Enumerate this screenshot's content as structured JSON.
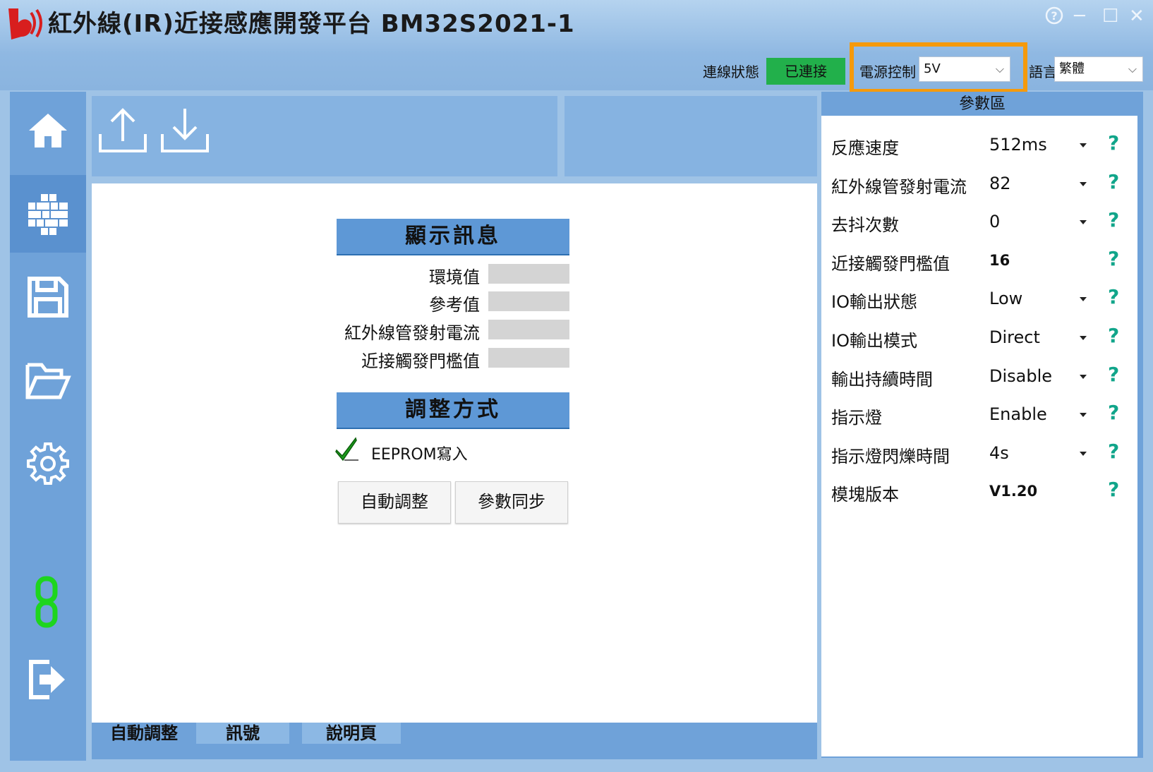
{
  "window": {
    "title": "紅外線(IR)近接感應開發平台 BM32S2021-1",
    "help_glyph": "?",
    "minimize_glyph": "─",
    "maximize_glyph": "☐",
    "close_glyph": "✕"
  },
  "status": {
    "connection_label": "連線狀態",
    "connection_value": "已連接",
    "connection_color": "#22b04b",
    "power_label": "電源控制",
    "power_value": "5V",
    "language_label": "語言",
    "language_value": "繁體",
    "highlight_color": "#f59a0c"
  },
  "sidebar": {
    "items": [
      {
        "icon": "home-icon"
      },
      {
        "icon": "grid-icon"
      },
      {
        "icon": "save-icon"
      },
      {
        "icon": "folder-open-icon"
      },
      {
        "icon": "gear-icon"
      },
      {
        "icon": "link-icon"
      },
      {
        "icon": "exit-icon"
      }
    ]
  },
  "toolbar": {
    "upload_icon": "upload-icon",
    "download_icon": "download-icon"
  },
  "display": {
    "title": "顯示訊息",
    "rows": [
      {
        "label": "環境值",
        "value": ""
      },
      {
        "label": "參考值",
        "value": ""
      },
      {
        "label": "紅外線管發射電流",
        "value": ""
      },
      {
        "label": "近接觸發門檻值",
        "value": ""
      }
    ]
  },
  "adjust": {
    "title": "調整方式",
    "checkbox_label": "EEPROM寫入",
    "checked": true,
    "auto_button": "自動調整",
    "sync_button": "參數同步"
  },
  "tabs": [
    {
      "label": "自動調整",
      "active": true
    },
    {
      "label": "訊號",
      "active": false
    },
    {
      "label": "說明頁",
      "active": false
    }
  ],
  "params": {
    "title": "參數區",
    "help_glyph": "?",
    "rows": [
      {
        "label": "反應速度",
        "value": "512ms",
        "dropdown": true
      },
      {
        "label": "紅外線管發射電流",
        "value": "82",
        "dropdown": true
      },
      {
        "label": "去抖次數",
        "value": "0",
        "dropdown": true
      },
      {
        "label": "近接觸發門檻值",
        "value": "16",
        "dropdown": false
      },
      {
        "label": "IO輸出狀態",
        "value": "Low",
        "dropdown": true
      },
      {
        "label": "IO輸出模式",
        "value": "Direct",
        "dropdown": true
      },
      {
        "label": "輸出持續時間",
        "value": "Disable",
        "dropdown": true
      },
      {
        "label": "指示燈",
        "value": "Enable",
        "dropdown": true
      },
      {
        "label": "指示燈閃爍時間",
        "value": "4s",
        "dropdown": true
      },
      {
        "label": "模塊版本",
        "value": "V1.20",
        "dropdown": false
      }
    ]
  }
}
